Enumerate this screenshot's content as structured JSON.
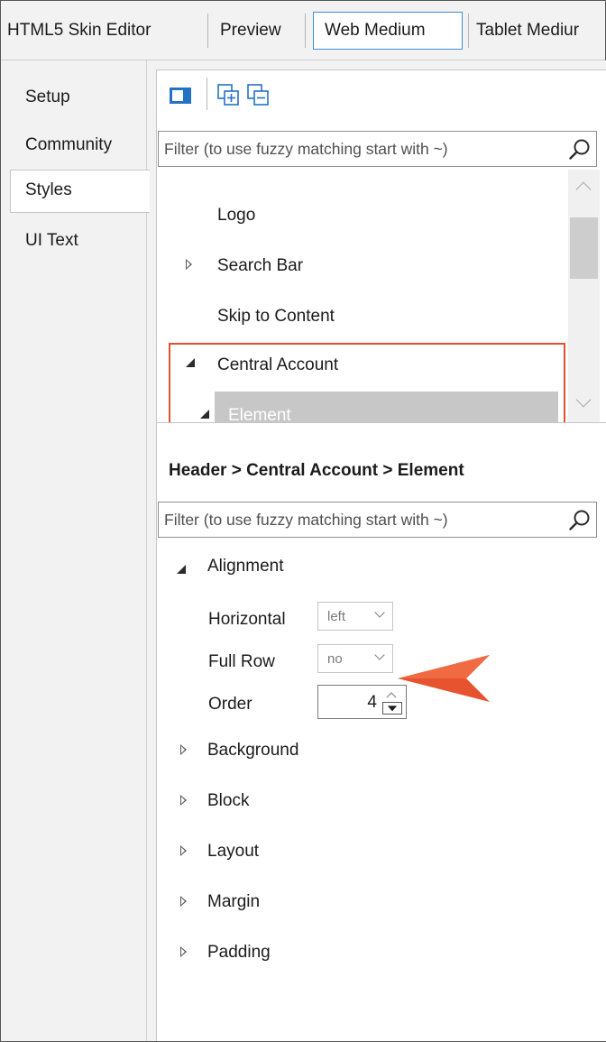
{
  "top_tabs": [
    "HTML5 Skin Editor",
    "Preview",
    "Web Medium",
    "Tablet Mediur"
  ],
  "left_tabs": [
    "Setup",
    "Community",
    "Styles",
    "UI Text"
  ],
  "selected_left_tab": "Styles",
  "selected_top_tab": "Web Medium",
  "toolbar": {
    "icons": [
      "sidebar-toggle-icon",
      "expand-all-icon",
      "collapse-all-icon"
    ]
  },
  "filter_top": {
    "placeholder": "Filter (to use fuzzy matching start with ~)"
  },
  "tree": {
    "items": [
      {
        "label": "Logo",
        "expander": "none"
      },
      {
        "label": "Search Bar",
        "expander": "collapsed"
      },
      {
        "label": "Skip to Content",
        "expander": "none"
      },
      {
        "label": "Central Account",
        "expander": "expanded",
        "highlighted": true
      },
      {
        "label": "Element",
        "expander": "expanded",
        "selected": true
      }
    ]
  },
  "breadcrumb": "Header > Central Account > Element",
  "filter_bottom": {
    "placeholder": "Filter (to use fuzzy matching start with ~)"
  },
  "properties": {
    "alignment": {
      "label": "Alignment",
      "expander": "expanded",
      "horizontal": {
        "label": "Horizontal",
        "value": "left"
      },
      "full_row": {
        "label": "Full Row",
        "value": "no"
      },
      "order": {
        "label": "Order",
        "value": "4"
      }
    },
    "groups": [
      {
        "label": "Background",
        "expander": "collapsed"
      },
      {
        "label": "Block",
        "expander": "collapsed"
      },
      {
        "label": "Layout",
        "expander": "collapsed"
      },
      {
        "label": "Margin",
        "expander": "collapsed"
      },
      {
        "label": "Padding",
        "expander": "collapsed"
      }
    ]
  },
  "colors": {
    "highlight_border": "#e0512e",
    "callout_arrow": "#e8532f",
    "selected_tab_border": "#3f8ed6",
    "tree_selection": "#c7c7c7",
    "accent_icon": "#2372c5"
  }
}
